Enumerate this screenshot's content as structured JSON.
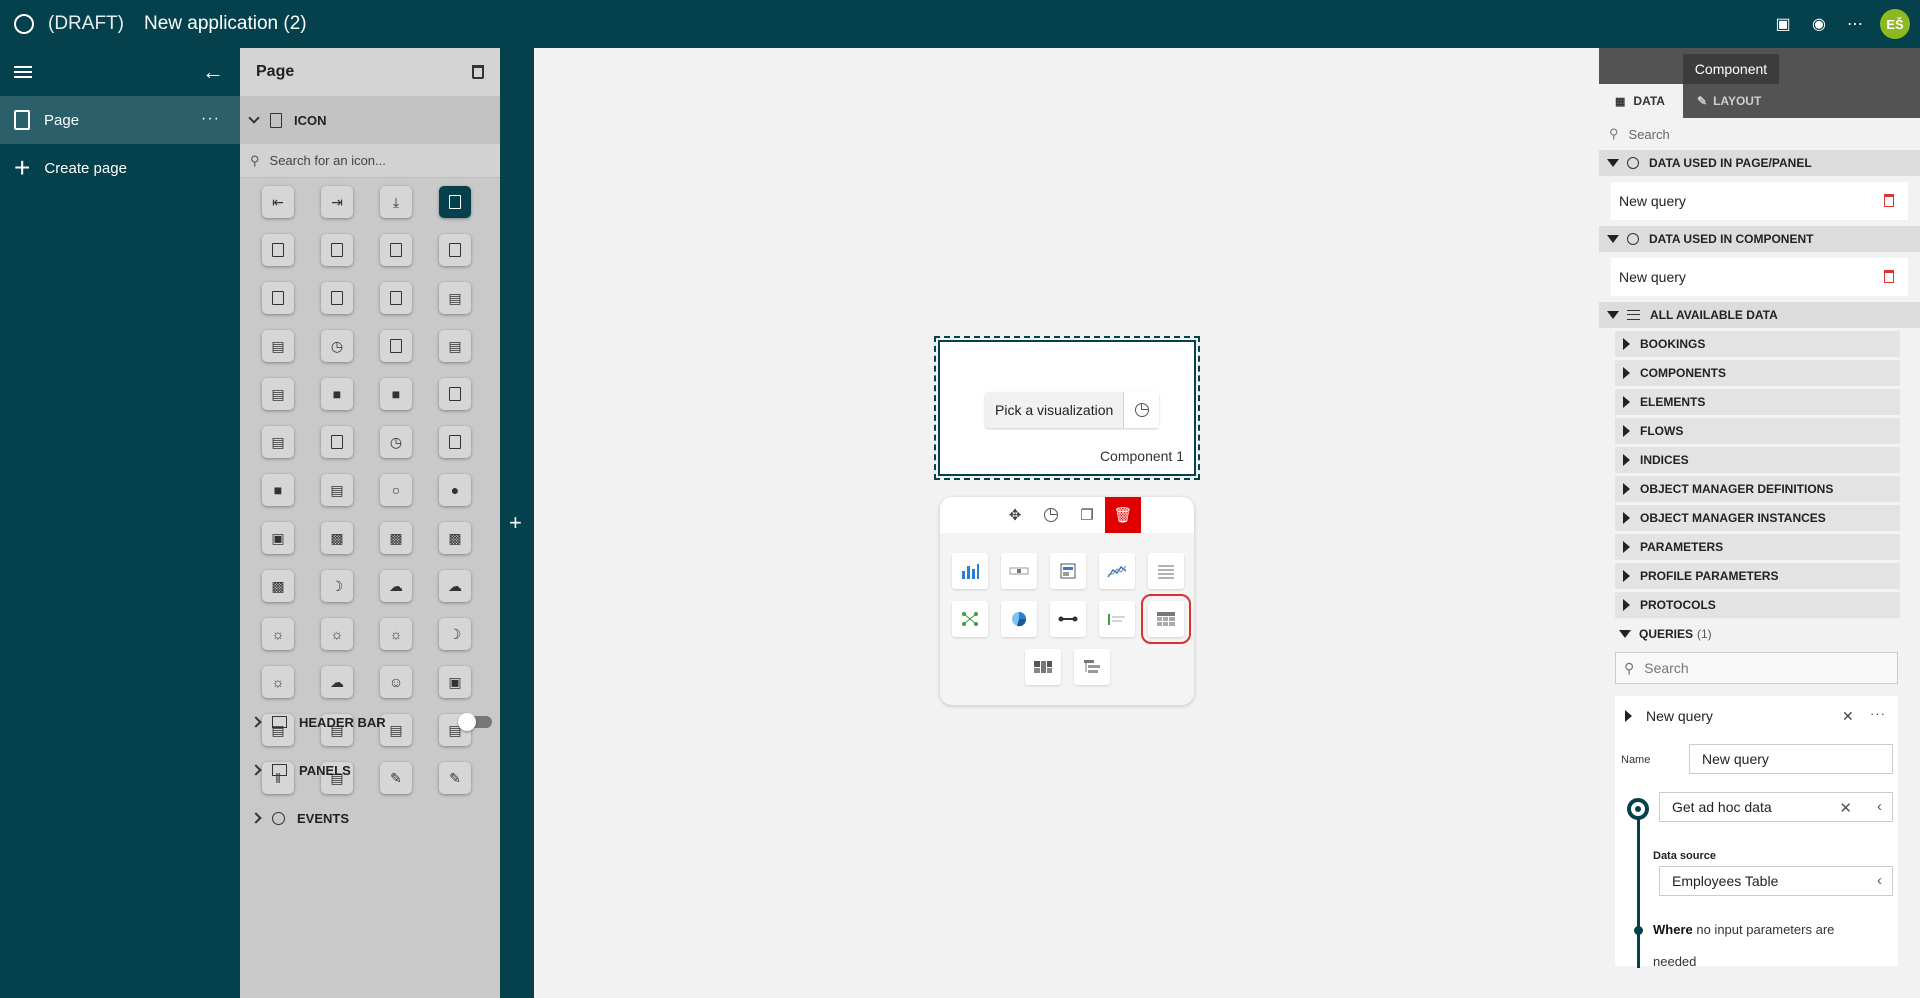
{
  "topbar": {
    "draft_label": "(DRAFT)",
    "app_name": "New application (2)",
    "avatar_initials": "EŠ",
    "avatar_color": "#8db820",
    "bar_color": "#04414d"
  },
  "leftnav": {
    "page_item": "Page",
    "create_page": "Create page"
  },
  "pagepanel": {
    "title": "Page",
    "icon_section": "ICON",
    "icon_search_placeholder": "Search for an icon...",
    "icon_count": 52,
    "selected_icon_index": 3,
    "header_bar": "HEADER BAR",
    "header_bar_enabled": false,
    "panels": "PANELS",
    "events": "EVENTS"
  },
  "canvas": {
    "pick_visualization": "Pick a visualization",
    "component_label": "Component 1"
  },
  "rightpanel": {
    "component_title": "Component",
    "tab_data": "DATA",
    "tab_layout": "LAYOUT",
    "search_placeholder": "Search",
    "section_page": "DATA USED IN PAGE/PANEL",
    "page_query": "New query",
    "section_component": "DATA USED IN COMPONENT",
    "component_query": "New query",
    "section_all": "ALL AVAILABLE DATA",
    "categories": [
      "BOOKINGS",
      "COMPONENTS",
      "ELEMENTS",
      "FLOWS",
      "INDICES",
      "OBJECT MANAGER DEFINITIONS",
      "OBJECT MANAGER INSTANCES",
      "PARAMETERS",
      "PROFILE PARAMETERS",
      "PROTOCOLS"
    ],
    "queries_label": "QUERIES",
    "queries_count": "(1)",
    "queries_search_placeholder": "Search",
    "query_card": {
      "title": "New query",
      "name_label": "Name",
      "name_value": "New query",
      "step_value": "Get ad hoc data",
      "datasource_label": "Data source",
      "datasource_value": "Employees Table",
      "where_bold": "Where",
      "where_text": "no input parameters are needed"
    }
  }
}
